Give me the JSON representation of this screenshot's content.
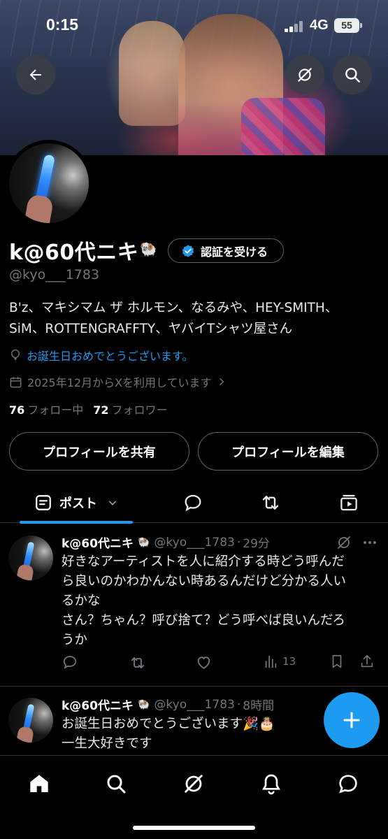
{
  "status_bar": {
    "time": "0:15",
    "network": "4G",
    "battery": "55"
  },
  "header": {
    "back_icon": "arrow-left-icon",
    "grok_icon": "grok-icon",
    "search_icon": "search-icon"
  },
  "profile": {
    "display_name": "k@60代ニキ",
    "name_emoji": "🐏",
    "verify_label": "認証を受ける",
    "handle": "@kyo___1783",
    "bio_line1": "B'z、マキシマム ザ ホルモン、なるみや、HEY-SMITH、",
    "bio_line2": "SiM、ROTTENGRAFFTY、ヤバイTシャツ屋さん",
    "birthday_text": "お誕生日おめでとうございます。",
    "joined_text": "2025年12月からXを利用しています",
    "following_count": "76",
    "following_label": "フォロー中",
    "followers_count": "72",
    "followers_label": "フォロワー",
    "share_button": "プロフィールを共有",
    "edit_button": "プロフィールを編集"
  },
  "tabs": {
    "posts_label": "ポスト",
    "replies_icon": "speech-bubble-icon",
    "reposts_icon": "repost-icon",
    "media_icon": "video-icon"
  },
  "posts": [
    {
      "name": "k@60代ニキ",
      "emoji": "🐏",
      "handle": "@kyo___1783",
      "time": "29分",
      "line1": "好きなアーティストを人に紹介する時どう呼んだ",
      "line2": "ら良いのかわかんない時あるんだけど分かる人い",
      "line3": "るかな",
      "line4": "さん？ちゃん？呼び捨て？どう呼べば良いんだろ",
      "line5": "うか",
      "views": "13"
    },
    {
      "name": "k@60代ニキ",
      "emoji": "🐏",
      "handle": "@kyo___1783",
      "time": "8時間",
      "line1": "お誕生日おめでとうございます🎉🎂",
      "line2": "一生大好きです"
    }
  ],
  "bottom_nav": {
    "items": [
      "home-icon",
      "search-icon",
      "grok-icon",
      "bell-icon",
      "messages-icon"
    ]
  },
  "colors": {
    "accent": "#1d9bf0",
    "muted": "#71767b",
    "border": "#2f3336"
  }
}
